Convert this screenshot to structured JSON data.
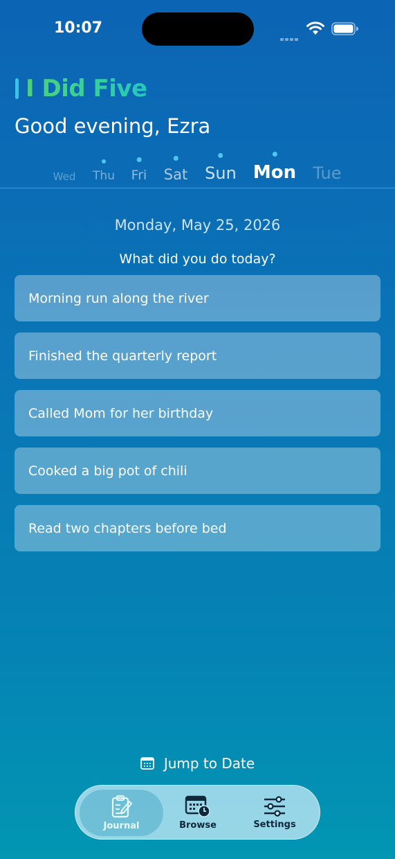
{
  "status_bar": {
    "time": "10:07"
  },
  "header": {
    "app_title": "I Did Five",
    "greeting": "Good evening, Ezra"
  },
  "week": [
    {
      "label": "Wed",
      "has_entry": false,
      "state": "past"
    },
    {
      "label": "Thu",
      "has_entry": true,
      "state": "past"
    },
    {
      "label": "Fri",
      "has_entry": true,
      "state": "past"
    },
    {
      "label": "Sat",
      "has_entry": true,
      "state": "past"
    },
    {
      "label": "Sun",
      "has_entry": true,
      "state": "past"
    },
    {
      "label": "Mon",
      "has_entry": true,
      "state": "selected"
    },
    {
      "label": "Tue",
      "has_entry": false,
      "state": "future"
    }
  ],
  "main": {
    "date": "Monday, May 25, 2026",
    "prompt": "What did you do today?",
    "entries": [
      "Morning run along the river",
      "Finished the quarterly report",
      "Called Mom for her birthday",
      "Cooked a big pot of chili",
      "Read two chapters before bed"
    ]
  },
  "bottom": {
    "jump_to_date": "Jump to Date",
    "tabs": [
      {
        "label": "Journal",
        "icon": "journal-icon",
        "active": true
      },
      {
        "label": "Browse",
        "icon": "calendar-clock-icon",
        "active": false
      },
      {
        "label": "Settings",
        "icon": "sliders-icon",
        "active": false
      }
    ]
  },
  "colors": {
    "accent_dot": "#4fc6ee",
    "brand_gradient_start": "#4fd07a",
    "brand_gradient_end": "#25c6c0"
  }
}
